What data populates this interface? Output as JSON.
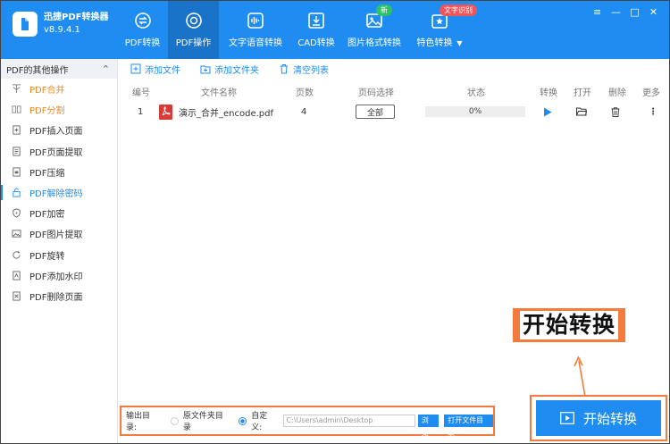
{
  "app": {
    "name": "迅捷PDF转换器",
    "version": "v8.9.4.1"
  },
  "nav": [
    {
      "label": "PDF转换",
      "icon": "pdf-convert-icon"
    },
    {
      "label": "PDF操作",
      "icon": "pdf-operate-icon",
      "active": true
    },
    {
      "label": "文字语音转换",
      "icon": "audio-wave-icon"
    },
    {
      "label": "CAD转换",
      "icon": "cad-icon"
    },
    {
      "label": "图片格式转换",
      "icon": "image-icon",
      "badge": "新"
    },
    {
      "label": "特色转换",
      "icon": "special-icon",
      "badge": "文字识别"
    }
  ],
  "window_controls": {
    "menu": "≡",
    "minimize": "—",
    "maximize": "□",
    "close": "✕"
  },
  "sidebar": {
    "header": "PDF的其他操作",
    "collapse_symbol": "⌃",
    "items": [
      {
        "label": "PDF合并",
        "icon": "merge-icon",
        "style": "orange"
      },
      {
        "label": "PDF分割",
        "icon": "split-icon",
        "style": "orange"
      },
      {
        "label": "PDF插入页面",
        "icon": "insert-page-icon"
      },
      {
        "label": "PDF页面提取",
        "icon": "extract-page-icon"
      },
      {
        "label": "PDF压缩",
        "icon": "compress-icon"
      },
      {
        "label": "PDF解除密码",
        "icon": "unlock-icon",
        "style": "blue",
        "active": true
      },
      {
        "label": "PDF加密",
        "icon": "shield-icon"
      },
      {
        "label": "PDF图片提取",
        "icon": "image-extract-icon"
      },
      {
        "label": "PDF旋转",
        "icon": "rotate-icon"
      },
      {
        "label": "PDF添加水印",
        "icon": "watermark-icon"
      },
      {
        "label": "PDF删除页面",
        "icon": "delete-page-icon"
      }
    ]
  },
  "toolbar": {
    "add_file": "添加文件",
    "add_folder": "添加文件夹",
    "clear_list": "清空列表"
  },
  "table": {
    "headers": {
      "index": "编号",
      "filename": "文件名称",
      "pages": "页数",
      "page_select": "页码选择",
      "status": "状态",
      "convert": "转换",
      "open": "打开",
      "delete": "删除",
      "more": "更多"
    },
    "rows": [
      {
        "index": "1",
        "filename": "演示_合并_encode.pdf",
        "pages": "4",
        "page_select": "全部",
        "progress_text": "0%",
        "progress": 0
      }
    ]
  },
  "more_symbol": "⋮",
  "output": {
    "label": "输出目录:",
    "option_source": "原文件夹目录",
    "option_custom": "自定义:",
    "path": "C:\\Users\\admin\\Desktop",
    "browse": "浏览",
    "open_folder": "打开文件目录"
  },
  "start_button": "开始转换",
  "callout_label": "开始转换",
  "colors": {
    "brand": "#1e8cf0",
    "accent_orange": "#f47b3b",
    "active_orange": "#f08a24"
  }
}
